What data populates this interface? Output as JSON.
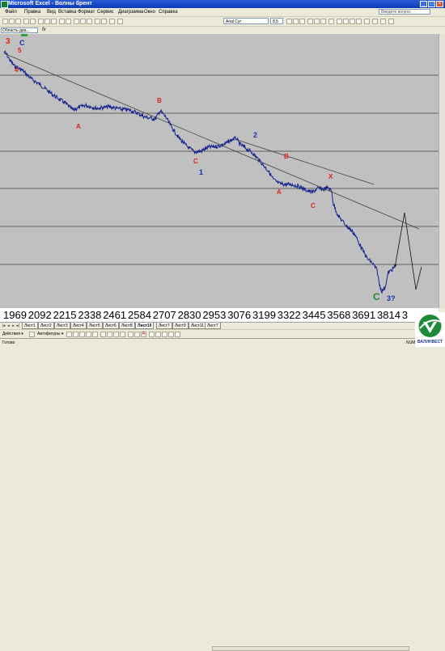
{
  "window": {
    "title": "Microsoft Excel - Волны брент"
  },
  "menu": {
    "items": [
      "Файл",
      "Правка",
      "Вид",
      "Вставка",
      "Формат",
      "Сервис",
      "Диаграмма",
      "Окно",
      "Справка"
    ],
    "ask_placeholder": "Введите вопрос"
  },
  "toolbar": {
    "font_name": "Arial Cyr",
    "font_size": "8,5"
  },
  "formula_bar": {
    "name_box": "Область диа...",
    "fx": "fx"
  },
  "chart_data": {
    "type": "line",
    "x_tick_labels": [
      "1969",
      "2092",
      "2215",
      "2338",
      "2461",
      "2584",
      "2707",
      "2830",
      "2953",
      "3076",
      "3199",
      "3322",
      "3445",
      "3568",
      "3691",
      "3814",
      "3"
    ],
    "gridlines": 6,
    "annotations": [
      {
        "text": "3",
        "color": "#e0231b"
      },
      {
        "text": "C",
        "color": "#1a2fb3"
      },
      {
        "text": "5",
        "color": "#e0231b"
      },
      {
        "text": "4",
        "color": "#e0231b"
      },
      {
        "text": "A",
        "color": "#e0231b"
      },
      {
        "text": "B",
        "color": "#e0231b"
      },
      {
        "text": "C",
        "color": "#e0231b"
      },
      {
        "text": "1",
        "color": "#1a2fb3"
      },
      {
        "text": "2",
        "color": "#1a2fb3"
      },
      {
        "text": "B",
        "color": "#e0231b"
      },
      {
        "text": "A",
        "color": "#e0231b"
      },
      {
        "text": "X",
        "color": "#e0231b"
      },
      {
        "text": "C",
        "color": "#e0231b"
      },
      {
        "text": "C",
        "color": "#1d8a2e"
      },
      {
        "text": "3?",
        "color": "#1a2fb3"
      }
    ],
    "series_color": "#0f1f8c",
    "trendline_color": "#404040"
  },
  "sheet_tabs": [
    "Лист1",
    "Лист2",
    "Лист3",
    "Лист4",
    "Лист5",
    "Лист6",
    "Лист8",
    "Лист10",
    "Лист7",
    "Лист9",
    "Лист11",
    "Лист7"
  ],
  "active_tab_index": 7,
  "draw_toolbar": {
    "actions": "Действия ▾",
    "autoshapes": "Автофигуры ▾"
  },
  "status": {
    "ready": "Готово",
    "num": "NUM"
  },
  "logo": {
    "text": "ВАЛИНВЕСТ"
  }
}
